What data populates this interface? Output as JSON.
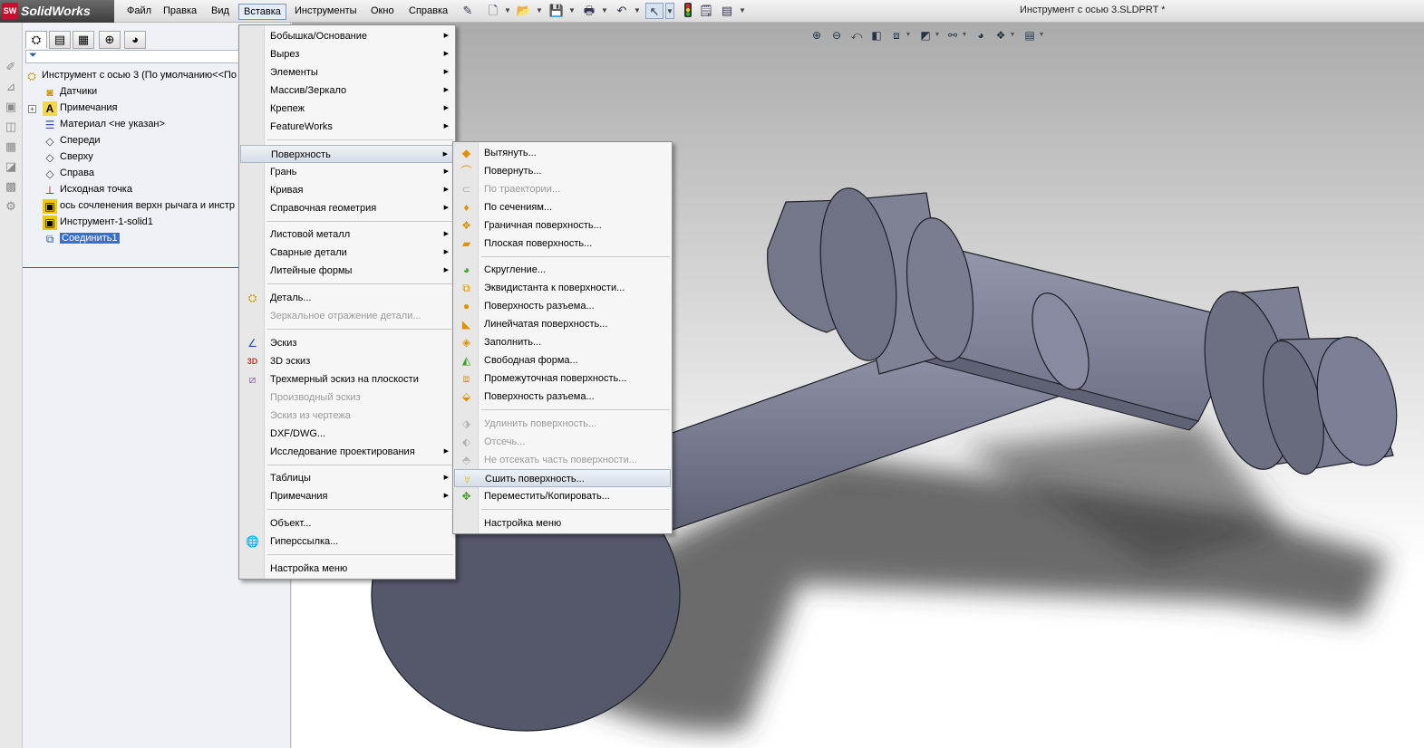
{
  "app": {
    "brand": "SolidWorks",
    "logo_badge": "SW",
    "document_title": "Инструмент с осью 3.SLDPRT *"
  },
  "menubar": {
    "items": [
      "Файл",
      "Правка",
      "Вид",
      "Вставка",
      "Инструменты",
      "Окно",
      "Справка"
    ],
    "open_item": "Вставка"
  },
  "feature_tree": {
    "root": "Инструмент с осью 3  (По умолчанию<<По",
    "items": [
      {
        "label": "Датчики",
        "icon": "sensors-icon"
      },
      {
        "label": "Примечания",
        "icon": "annotations-icon",
        "expandable": true
      },
      {
        "label": "Материал <не указан>",
        "icon": "material-icon"
      },
      {
        "label": "Спереди",
        "icon": "plane-icon"
      },
      {
        "label": "Сверху",
        "icon": "plane-icon"
      },
      {
        "label": "Справа",
        "icon": "plane-icon"
      },
      {
        "label": "Исходная точка",
        "icon": "origin-icon"
      },
      {
        "label": "ось  сочленения верхн рычага и инстр",
        "icon": "part-icon"
      },
      {
        "label": "Инструмент-1-solid1",
        "icon": "part-icon"
      },
      {
        "label": "Соединить1",
        "icon": "combine-icon",
        "selected": true
      }
    ]
  },
  "insert_menu": {
    "items": [
      {
        "label": "Бобышка/Основание",
        "submenu": true
      },
      {
        "label": "Вырез",
        "submenu": true
      },
      {
        "label": "Элементы",
        "submenu": true
      },
      {
        "label": "Массив/Зеркало",
        "submenu": true
      },
      {
        "label": "Крепеж",
        "submenu": true
      },
      {
        "label": "FeatureWorks",
        "submenu": true
      },
      {
        "label": "Поверхность",
        "submenu": true,
        "highlighted": true
      },
      {
        "label": "Грань",
        "submenu": true
      },
      {
        "label": "Кривая",
        "submenu": true
      },
      {
        "label": "Справочная геометрия",
        "submenu": true
      },
      {
        "label": "Листовой металл",
        "submenu": true
      },
      {
        "label": "Сварные детали",
        "submenu": true
      },
      {
        "label": "Литейные формы",
        "submenu": true
      },
      {
        "label": "Деталь...",
        "icon": "part-insert-icon"
      },
      {
        "label": "Зеркальное отражение детали...",
        "disabled": true
      },
      {
        "label": "Эскиз",
        "icon": "sketch-icon"
      },
      {
        "label": "3D эскиз",
        "icon": "3d-sketch-icon"
      },
      {
        "label": "Трехмерный эскиз на плоскости",
        "icon": "3d-sketch-plane-icon"
      },
      {
        "label": "Производный эскиз",
        "disabled": true
      },
      {
        "label": "Эскиз из чертежа",
        "disabled": true
      },
      {
        "label": "DXF/DWG..."
      },
      {
        "label": "Исследование проектирования",
        "submenu": true
      },
      {
        "label": "Таблицы",
        "submenu": true
      },
      {
        "label": "Примечания",
        "submenu": true
      },
      {
        "label": "Объект..."
      },
      {
        "label": "Гиперссылка...",
        "icon": "hyperlink-icon"
      },
      {
        "label": "Настройка меню"
      }
    ]
  },
  "surface_submenu": {
    "items": [
      {
        "label": "Вытянуть...",
        "icon": "extrude-surface-icon"
      },
      {
        "label": "Повернуть...",
        "icon": "revolve-surface-icon"
      },
      {
        "label": "По траектории...",
        "icon": "sweep-surface-icon",
        "disabled": true
      },
      {
        "label": "По сечениям...",
        "icon": "loft-surface-icon"
      },
      {
        "label": "Граничная поверхность...",
        "icon": "boundary-surface-icon"
      },
      {
        "label": "Плоская поверхность...",
        "icon": "planar-surface-icon"
      },
      {
        "label": "Скругление...",
        "icon": "fillet-icon"
      },
      {
        "label": "Эквидистанта к поверхности...",
        "icon": "offset-surface-icon"
      },
      {
        "label": "Поверхность разъема...",
        "icon": "radiate-surface-icon"
      },
      {
        "label": "Линейчатая поверхность...",
        "icon": "ruled-surface-icon"
      },
      {
        "label": "Заполнить...",
        "icon": "fill-surface-icon"
      },
      {
        "label": "Свободная форма...",
        "icon": "freeform-icon"
      },
      {
        "label": "Промежуточная поверхность...",
        "icon": "mid-surface-icon"
      },
      {
        "label": "Поверхность разъема...",
        "icon": "parting-surface-icon"
      },
      {
        "label": "Удлинить поверхность...",
        "icon": "extend-surface-icon",
        "disabled": true
      },
      {
        "label": "Отсечь...",
        "icon": "trim-surface-icon",
        "disabled": true
      },
      {
        "label": "Не отсекать часть поверхности...",
        "icon": "untrim-surface-icon",
        "disabled": true
      },
      {
        "label": "Сшить поверхность...",
        "icon": "knit-surface-icon",
        "highlighted": true
      },
      {
        "label": "Переместить/Копировать...",
        "icon": "move-copy-icon"
      },
      {
        "label": "Настройка меню"
      }
    ]
  },
  "colors": {
    "model_fill": "#7c7f95",
    "model_dark": "#555766",
    "selection": "#3a6fc6",
    "logo_red": "#c8102e"
  }
}
